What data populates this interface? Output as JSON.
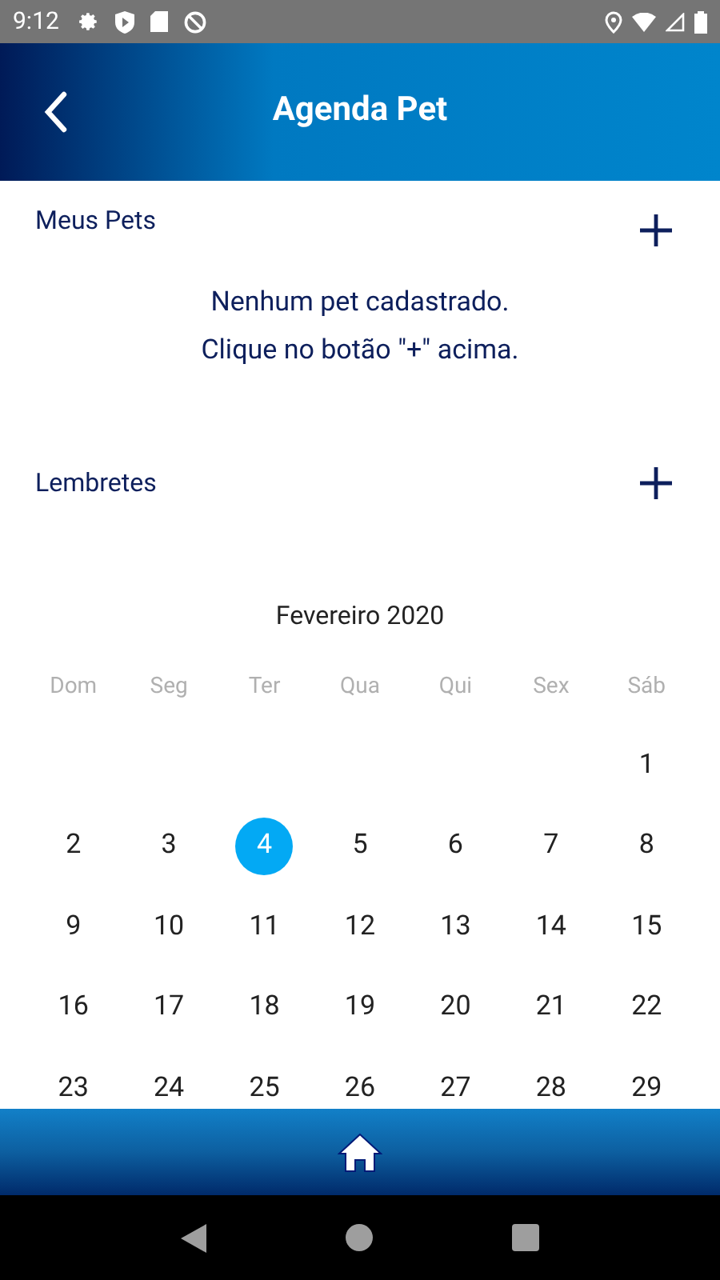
{
  "status_bar": {
    "time": "9:12"
  },
  "header": {
    "title": "Agenda Pet"
  },
  "pets": {
    "title": "Meus Pets",
    "empty_lines": [
      "Nenhum pet cadastrado.",
      "Clique no botão \"+\" acima."
    ]
  },
  "reminders": {
    "title": "Lembretes"
  },
  "calendar": {
    "month": "Fevereiro 2020",
    "weekdays": [
      "Dom",
      "Seg",
      "Ter",
      "Qua",
      "Qui",
      "Sex",
      "Sáb"
    ],
    "weeks": [
      {
        "right_aligned": true,
        "days": [
          {
            "day": "1",
            "selected": false
          }
        ]
      },
      {
        "days": [
          {
            "day": "2",
            "selected": false
          },
          {
            "day": "3",
            "selected": false
          },
          {
            "day": "4",
            "selected": true
          },
          {
            "day": "5",
            "selected": false
          },
          {
            "day": "6",
            "selected": false
          },
          {
            "day": "7",
            "selected": false
          },
          {
            "day": "8",
            "selected": false
          }
        ]
      },
      {
        "days": [
          {
            "day": "9",
            "selected": false
          },
          {
            "day": "10",
            "selected": false
          },
          {
            "day": "11",
            "selected": false
          },
          {
            "day": "12",
            "selected": false
          },
          {
            "day": "13",
            "selected": false
          },
          {
            "day": "14",
            "selected": false
          },
          {
            "day": "15",
            "selected": false
          }
        ]
      },
      {
        "days": [
          {
            "day": "16",
            "selected": false
          },
          {
            "day": "17",
            "selected": false
          },
          {
            "day": "18",
            "selected": false
          },
          {
            "day": "19",
            "selected": false
          },
          {
            "day": "20",
            "selected": false
          },
          {
            "day": "21",
            "selected": false
          },
          {
            "day": "22",
            "selected": false
          }
        ]
      },
      {
        "days": [
          {
            "day": "23",
            "selected": false
          },
          {
            "day": "24",
            "selected": false
          },
          {
            "day": "25",
            "selected": false
          },
          {
            "day": "26",
            "selected": false
          },
          {
            "day": "27",
            "selected": false
          },
          {
            "day": "28",
            "selected": false
          },
          {
            "day": "29",
            "selected": false
          }
        ]
      }
    ]
  }
}
